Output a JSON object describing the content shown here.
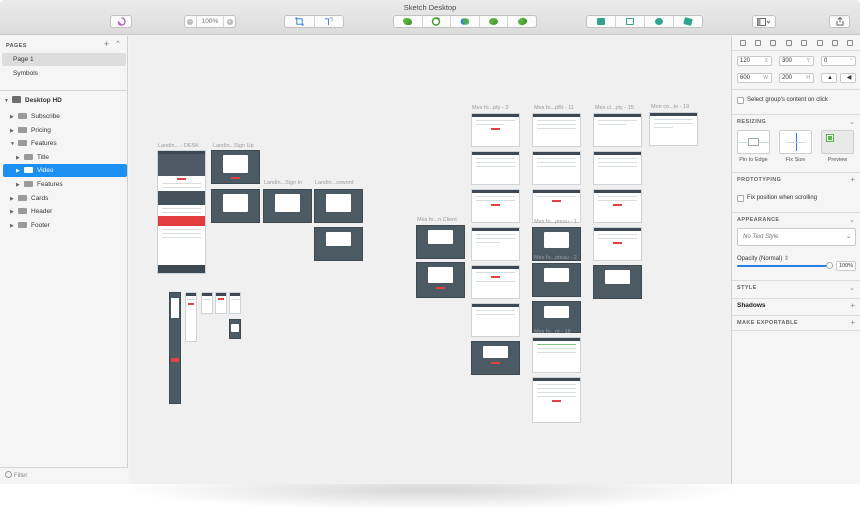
{
  "window": {
    "title": "Sketch Desktop"
  },
  "toolbar": {
    "zoom": "100%"
  },
  "pages": {
    "header": "PAGES",
    "items": [
      "Page 1",
      "Symbols"
    ]
  },
  "layers": {
    "artboard": "Desktop HD",
    "items": [
      "Subscribe",
      "Pricing",
      "Features",
      "Title",
      "Video",
      "Features",
      "Cards",
      "Header",
      "Footer"
    ]
  },
  "filter_placeholder": "Filter",
  "artboards": {
    "labels": [
      "Landin... - DESK",
      "Landin...Sign Up",
      "Landin...Sign In",
      "Landin...ssword",
      "Mes fo...n Client",
      "Mes fo...pty - 3",
      "Mes fo...pBt - 11",
      "Mes cl...pty - 15",
      "Mon co...te - 19",
      "Mes fo...pteau - 1",
      "Mes fo...pteau - 2",
      "Mes fo...nt - 18"
    ]
  },
  "inspector": {
    "x": "120",
    "x_unit": "X",
    "y": "300",
    "y_unit": "Y",
    "rot": "0",
    "w": "600",
    "w_unit": "W",
    "h": "200",
    "h_unit": "H",
    "group_click": "Select group's content on click",
    "resizing": "RESIZING",
    "pin": "Pin to Edge",
    "fix": "Fix Size",
    "preview": "Preview",
    "prototyping": "PROTOTYPING",
    "fix_scroll": "Fix position when scrolling",
    "appearance": "APPEARANCE",
    "text_style": "No Text Style",
    "opacity_label": "Opacity (Normal)",
    "opacity": "100%",
    "style": "STYLE",
    "shadows": "Shadows",
    "export": "MAKE EXPORTABLE"
  }
}
